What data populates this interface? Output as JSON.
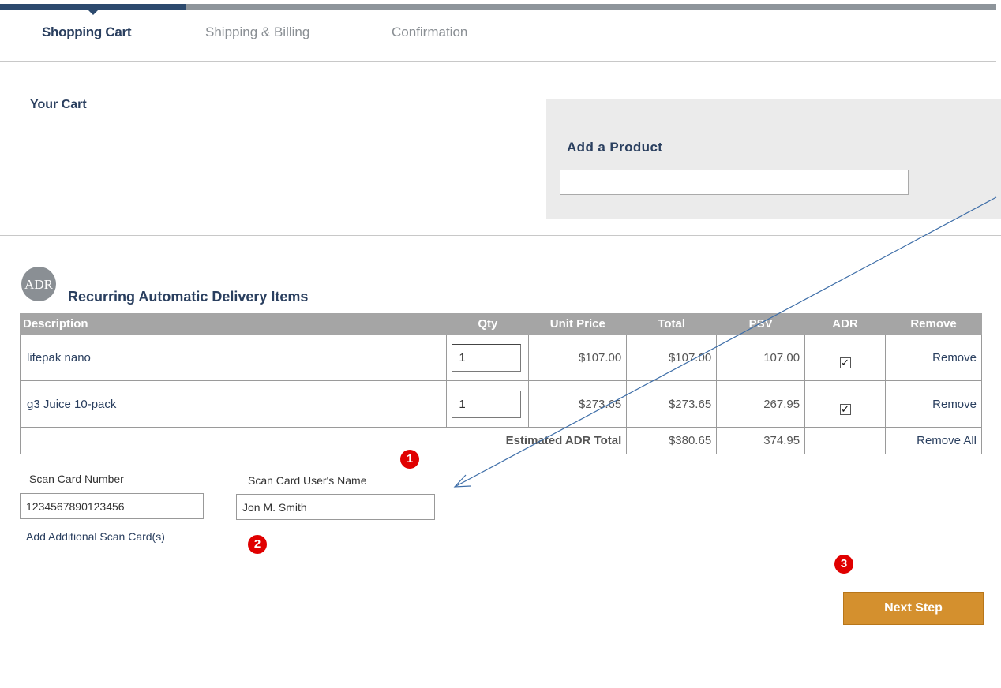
{
  "steps": [
    {
      "label": "Shopping Cart",
      "active": true
    },
    {
      "label": "Shipping & Billing",
      "active": false
    },
    {
      "label": "Confirmation",
      "active": false
    }
  ],
  "progress_fraction": 0.187,
  "cart": {
    "title": "Your Cart"
  },
  "add_product": {
    "title": "Add a Product",
    "value": ""
  },
  "adr": {
    "icon_text": "ADR",
    "title": "Recurring Automatic Delivery Items",
    "columns": [
      "Description",
      "Qty",
      "Unit Price",
      "Total",
      "PSV",
      "ADR",
      "Remove"
    ],
    "items": [
      {
        "description": "lifepak nano",
        "qty": "1",
        "unit_price": "$107.00",
        "total": "$107.00",
        "psv": "107.00",
        "adr_checked": true,
        "remove": "Remove"
      },
      {
        "description": "g3 Juice 10-pack",
        "qty": "1",
        "unit_price": "$273.65",
        "total": "$273.65",
        "psv": "267.95",
        "adr_checked": true,
        "remove": "Remove"
      }
    ],
    "total_label": "Estimated ADR Total",
    "total_amount": "$380.65",
    "total_psv": "374.95",
    "remove_all": "Remove All"
  },
  "scan_card": {
    "number_label": "Scan Card Number",
    "number_value": "1234567890123456",
    "name_label": "Scan Card User's Name",
    "name_value": "Jon M. Smith",
    "add_link": "Add Additional Scan Card(s)"
  },
  "markers": [
    "1",
    "2",
    "3"
  ],
  "next_step_label": "Next Step",
  "colors": {
    "primary": "#2a3f5f",
    "accent": "#d4902e",
    "marker": "#e00000",
    "header_gray": "#a5a5a5",
    "panel_gray": "#ebebeb"
  }
}
